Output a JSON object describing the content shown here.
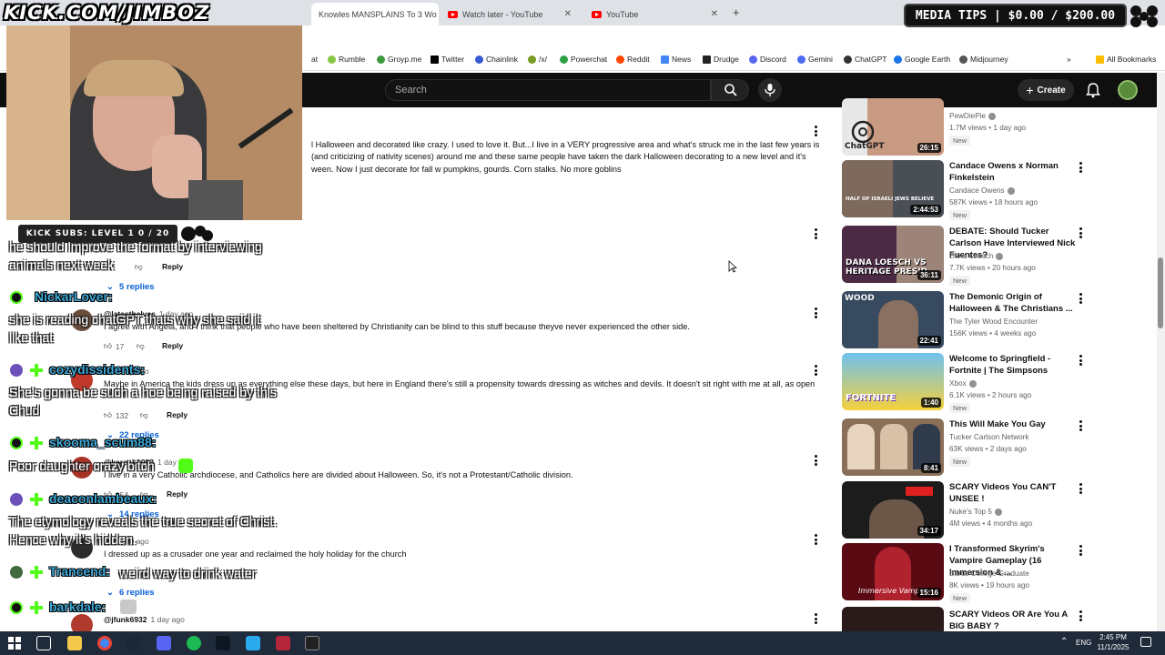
{
  "browser": {
    "tabs": [
      {
        "label": "Knowles MANSPLAINS To 3 Wo",
        "active": true
      },
      {
        "label": "Watch later - YouTube",
        "active": false
      },
      {
        "label": "YouTube",
        "active": false
      }
    ],
    "new_tab_icon": "plus-icon",
    "bookmarks": [
      "Rumble",
      "Groyp.me",
      "Twitter",
      "Chainlink",
      "/x/",
      "Powerchat",
      "Reddit",
      "News",
      "Drudge",
      "Discord",
      "Gemini",
      "ChatGPT",
      "Google Earth",
      "Midjourney"
    ],
    "bookmark_partial": "at",
    "all_bookmarks": "All Bookmarks"
  },
  "youtube": {
    "search_placeholder": "Search",
    "create_label": "Create"
  },
  "comments": [
    {
      "text_lines": [
        "l Halloween and decorated like crazy. I used to love it. But...I live in a VERY progressive area and what's struck me in the last few years is",
        "(and criticizing of nativity scenes) around me and these same people have taken the dark Halloween decorating to a new level and it's",
        "ween. Now I just decorate for fall w pumpkins, gourds. Corn stalks. No more goblins"
      ]
    },
    {
      "reply_label": "Reply",
      "replies": "5 replies"
    },
    {
      "author": "@latesthalves",
      "time": "1 day ago",
      "text_lines": [
        "I agree with Angela, and I think that people who have been sheltered by Christianity can be blind to this stuff because theyve never experienced the other side."
      ],
      "likes": "17",
      "reply_label": "Reply"
    },
    {
      "author": "@",
      "time": "1 day ago",
      "text_lines": [
        "Maybe in America the kids dress up as everything else these days, but here in England there's still a propensity towards dressing as witches and devils. It doesn't sit right with me at all, as open"
      ],
      "likes": "132",
      "reply_label": "Reply",
      "replies": "22 replies"
    },
    {
      "author": "@karenb1993",
      "time": "1 day ago",
      "text_lines": [
        "I live in a very Catholic archdiocese, and Catholics here are divided about Halloween. So, it's not a Protestant/Catholic division."
      ],
      "likes": "154",
      "reply_label": "Reply",
      "replies": "14 replies"
    },
    {
      "author": "@",
      "time": "1 day ago",
      "text_lines": [
        "I dressed up as a crusader one year and reclaimed the holy holiday for the church"
      ],
      "replies": "6 replies"
    },
    {
      "author": "@jfunk6932",
      "time": "1 day ago"
    }
  ],
  "sidebar_videos": [
    {
      "title": "",
      "channel": "PewDiePie",
      "views": "1.7M views",
      "age": "1 day ago",
      "badge": "New",
      "duration": "26:15",
      "thumb_text": "ChatGPT"
    },
    {
      "title": "Candace Owens x Norman Finkelstein",
      "channel": "Candace Owens",
      "views": "587K views",
      "age": "18 hours ago",
      "badge": "New",
      "duration": "2:44:53",
      "thumb_text": "HALF OF ISRAELI JEWS BELIEVE"
    },
    {
      "title": "DEBATE: Should Tucker Carlson Have Interviewed Nick Fuentes?",
      "channel": "Dana Loesch",
      "views": "7.7K views",
      "age": "20 hours ago",
      "badge": "New",
      "duration": "36:11",
      "thumb_text": "DANA LOESCH VS HERITAGE PRESID..."
    },
    {
      "title": "The Demonic Origin of Halloween & The Christians ...",
      "channel": "The Tyler Wood Encounter",
      "views": "156K views",
      "age": "4 weeks ago",
      "badge": "",
      "duration": "22:41",
      "thumb_text": "WOOD"
    },
    {
      "title": "Welcome to Springfield - Fortnite | The Simpsons",
      "channel": "Xbox",
      "views": "6.1K views",
      "age": "2 hours ago",
      "badge": "New",
      "duration": "1:40",
      "thumb_text": "FORTNITE"
    },
    {
      "title": "This Will Make You Gay",
      "channel": "Tucker Carlson Network",
      "views": "63K views",
      "age": "2 days ago",
      "badge": "New",
      "duration": "8:41",
      "thumb_text": ""
    },
    {
      "title": "SCARY Videos You CAN'T UNSEE !",
      "channel": "Nuke's Top 5",
      "views": "4M views",
      "age": "4 months ago",
      "badge": "",
      "duration": "34:17",
      "thumb_text": ""
    },
    {
      "title": "I Transformed Skyrim's Vampire Gameplay (16 Immersion & ...",
      "channel": "Bards College Graduate",
      "views": "8K views",
      "age": "19 hours ago",
      "badge": "New",
      "duration": "15:16",
      "thumb_text": "Immersive Vampires"
    },
    {
      "title": "SCARY Videos OR Are You A BIG BABY ?",
      "channel": "",
      "views": "",
      "age": "",
      "badge": "",
      "duration": "",
      "thumb_text": ""
    }
  ],
  "overlay": {
    "stream_url": "KICK.COM/JIMBOZ",
    "media_tips": "MEDIA TIPS | $0.00 / $200.00",
    "kick_subs": "KICK SUBS: LEVEL 1 0 / 20",
    "chat": [
      {
        "user": "",
        "lines": [
          "he should improve the format by interviewing",
          "animals next week"
        ]
      },
      {
        "user": "NickarLover:",
        "lines": [
          "she is reading chatGPT thats why she said it",
          "like that"
        ]
      },
      {
        "user": "cozydissidents:",
        "lines": [
          "She's gonna be such a hoe being raised by this",
          "Chud"
        ]
      },
      {
        "user": "skooma_scum88:",
        "lines": [
          "Poor daughter crazy bitch"
        ]
      },
      {
        "user": "deaconlambeaux:",
        "lines": [
          "The etymology reveals the true secret of Christ.",
          "Hence why it's hidden."
        ]
      },
      {
        "user": "Trancend:",
        "lines": [
          "weird way to drink water"
        ]
      },
      {
        "user": "barkdale:",
        "lines": []
      }
    ]
  },
  "taskbar": {
    "language": "ENG",
    "time": "2:45 PM",
    "date": "11/1/2025"
  },
  "colors": {
    "youtube_red": "#ff0000",
    "link_blue": "#065fd4",
    "chat_user": "#3fa9d8",
    "kick_green": "#53fc18"
  }
}
